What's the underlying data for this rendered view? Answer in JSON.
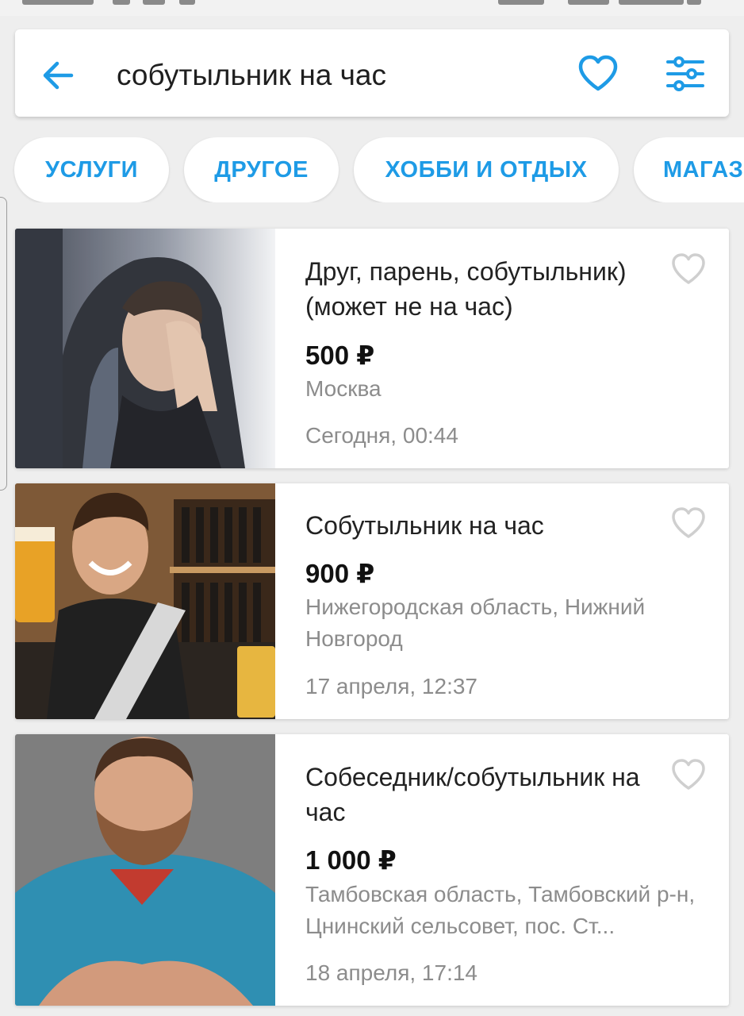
{
  "search": {
    "query": "собутыльник на час"
  },
  "chips": [
    "УСЛУГИ",
    "ДРУГОЕ",
    "ХОББИ И ОТДЫХ",
    "МАГАЗ"
  ],
  "listings": [
    {
      "title": "Друг, парень, собутыльник) (может не на час)",
      "price": "500 ₽",
      "location": "Москва",
      "date": "Сегодня, 00:44"
    },
    {
      "title": "Собутыльник на час",
      "price": "900 ₽",
      "location": "Нижегородская область, Нижний Новгород",
      "date": "17 апреля, 12:37"
    },
    {
      "title": "Собеседник/собутыльник на час",
      "price": "1 000 ₽",
      "location": "Тамбовская область, Тамбовский р-н, Цнинский сельсовет, пос. Ст...",
      "date": "18 апреля, 17:14"
    }
  ],
  "icons": {
    "back": "arrow-left-icon",
    "favorite": "heart-icon",
    "filter": "sliders-icon"
  },
  "colors": {
    "accent": "#1e9be6",
    "muted_text": "#8c8c8c",
    "background": "#eeeeee"
  }
}
